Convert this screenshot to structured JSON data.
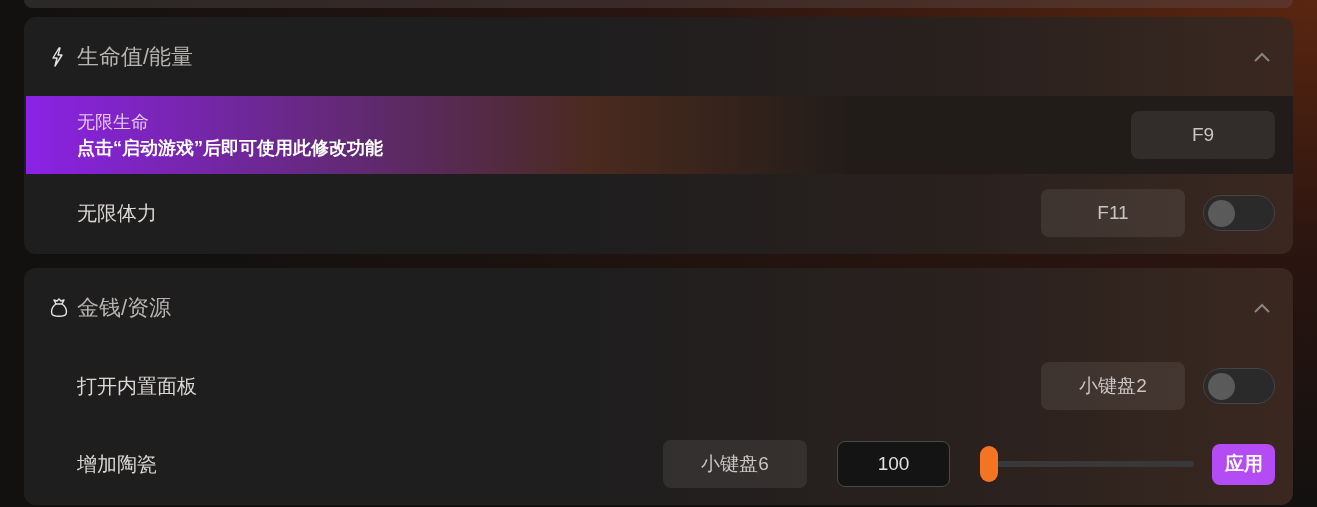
{
  "sections": [
    {
      "title": "生命值/能量",
      "kind": "bolt",
      "expanded": true,
      "rows": [
        {
          "kind": "hint",
          "label": "无限生命",
          "hint": "点击“启动游戏”后即可使用此修改功能",
          "hotkey": "F9"
        },
        {
          "kind": "toggle",
          "label": "无限体力",
          "hotkey": "F11",
          "on": false
        }
      ]
    },
    {
      "title": "金钱/资源",
      "kind": "bag",
      "expanded": true,
      "rows": [
        {
          "kind": "toggle",
          "label": "打开内置面板",
          "hotkey": "小键盘2",
          "on": false
        },
        {
          "kind": "slider",
          "label": "增加陶瓷",
          "hotkey": "小键盘6",
          "value": "100",
          "level": 0,
          "button": "应用"
        }
      ]
    }
  ]
}
